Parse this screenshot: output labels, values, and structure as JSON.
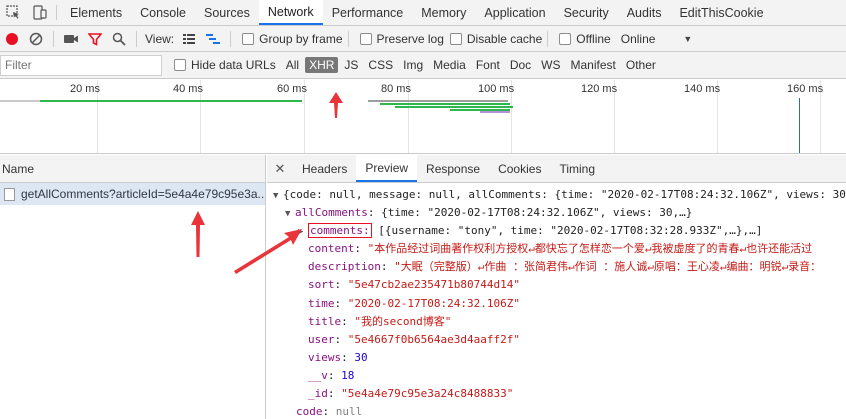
{
  "devtools_tabs": [
    "Elements",
    "Console",
    "Sources",
    "Network",
    "Performance",
    "Memory",
    "Application",
    "Security",
    "Audits",
    "EditThisCookie"
  ],
  "active_tab": "Network",
  "toolbar": {
    "view_label": "View:",
    "group_by_frame": "Group by frame",
    "preserve_log": "Preserve log",
    "disable_cache": "Disable cache",
    "offline": "Offline",
    "throttle": "Online"
  },
  "filter": {
    "placeholder": "Filter",
    "hide_data_urls": "Hide data URLs",
    "types": [
      "All",
      "XHR",
      "JS",
      "CSS",
      "Img",
      "Media",
      "Font",
      "Doc",
      "WS",
      "Manifest",
      "Other"
    ],
    "active_type": "XHR"
  },
  "timeline": {
    "ticks": [
      "20 ms",
      "40 ms",
      "60 ms",
      "80 ms",
      "100 ms",
      "120 ms",
      "140 ms",
      "160 ms"
    ]
  },
  "requests": {
    "header": "Name",
    "items": [
      "getAllComments?articleId=5e4a4e79c95e3a..."
    ]
  },
  "detail_tabs": [
    "Headers",
    "Preview",
    "Response",
    "Cookies",
    "Timing"
  ],
  "active_detail_tab": "Preview",
  "preview": {
    "root": "{code: null, message: null, allComments: {time: \"2020-02-17T08:24:32.106Z\", views: 30",
    "allComments_key": "allComments",
    "allComments_summary": ": {time: \"2020-02-17T08:24:32.106Z\", views: 30,…}",
    "comments_key": "comments:",
    "comments_summary": " [{username: \"tony\", time: \"2020-02-17T08:32:28.933Z\",…},…]",
    "content_key": "content",
    "content_val": "\"本作品经过词曲著作权利方授权↵都快忘了怎样恋一个爱↵我被虚度了的青春↵也许还能活过",
    "description_key": "description",
    "description_val": "\"大眠（完整版）↵作曲 ：张简君伟↵作词 ：施人诚↵原唱：王心凌↵编曲：明锐↵录音：",
    "sort_key": "sort",
    "sort_val": "\"5e47cb2ae235471b80744d14\"",
    "time_key": "time",
    "time_val": "\"2020-02-17T08:24:32.106Z\"",
    "title_key": "title",
    "title_val": "\"我的second博客\"",
    "user_key": "user",
    "user_val": "\"5e4667f0b6564ae3d4aaff2f\"",
    "views_key": "views",
    "views_val": "30",
    "v_key": "__v",
    "v_val": "18",
    "id_key": "_id",
    "id_val": "\"5e4a4e79c95e3a24c8488833\"",
    "code_key": "code",
    "code_val": "null",
    "message_key": "message",
    "message_val": "null"
  },
  "colors": {
    "accent": "#1a73e8",
    "record": "#e81123",
    "annotation": "#e8353a"
  }
}
